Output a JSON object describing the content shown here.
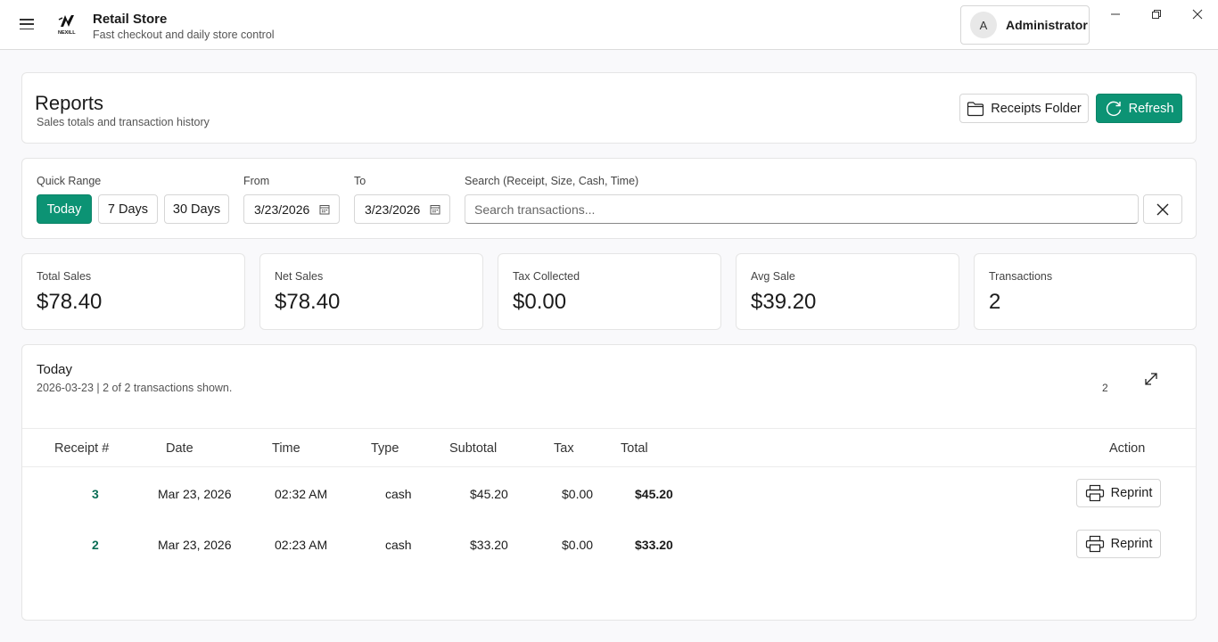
{
  "app": {
    "title": "Retail Store",
    "subtitle": "Fast checkout and daily store control",
    "logo_text": "NEXILL"
  },
  "user": {
    "initial": "A",
    "name": "Administrator"
  },
  "page": {
    "title": "Reports",
    "subtitle": "Sales totals and transaction history",
    "receipts_folder_label": "Receipts Folder",
    "refresh_label": "Refresh"
  },
  "filters": {
    "quick_range_label": "Quick Range",
    "ranges": [
      "Today",
      "7 Days",
      "30 Days"
    ],
    "active_range": "Today",
    "from_label": "From",
    "from_value": "3/23/2026",
    "to_label": "To",
    "to_value": "3/23/2026",
    "search_label": "Search (Receipt, Size, Cash, Time)",
    "search_placeholder": "Search transactions...",
    "search_value": ""
  },
  "stats": [
    {
      "label": "Total Sales",
      "value": "$78.40"
    },
    {
      "label": "Net Sales",
      "value": "$78.40"
    },
    {
      "label": "Tax Collected",
      "value": "$0.00"
    },
    {
      "label": "Avg Sale",
      "value": "$39.20"
    },
    {
      "label": "Transactions",
      "value": "2"
    }
  ],
  "transactions": {
    "title": "Today",
    "subtitle": "2026-03-23 | 2 of 2 transactions shown.",
    "count": "2",
    "columns": [
      "Receipt #",
      "Date",
      "Time",
      "Type",
      "Subtotal",
      "Tax",
      "Total",
      "Action"
    ],
    "rows": [
      {
        "receipt": "3",
        "date": "Mar 23, 2026",
        "time": "02:32 AM",
        "type": "cash",
        "subtotal": "$45.20",
        "tax": "$0.00",
        "total": "$45.20",
        "action": "Reprint"
      },
      {
        "receipt": "2",
        "date": "Mar 23, 2026",
        "time": "02:23 AM",
        "type": "cash",
        "subtotal": "$33.20",
        "tax": "$0.00",
        "total": "$33.20",
        "action": "Reprint"
      }
    ]
  },
  "colors": {
    "accent": "#0c9374",
    "receipt_link": "#0a6e55"
  }
}
